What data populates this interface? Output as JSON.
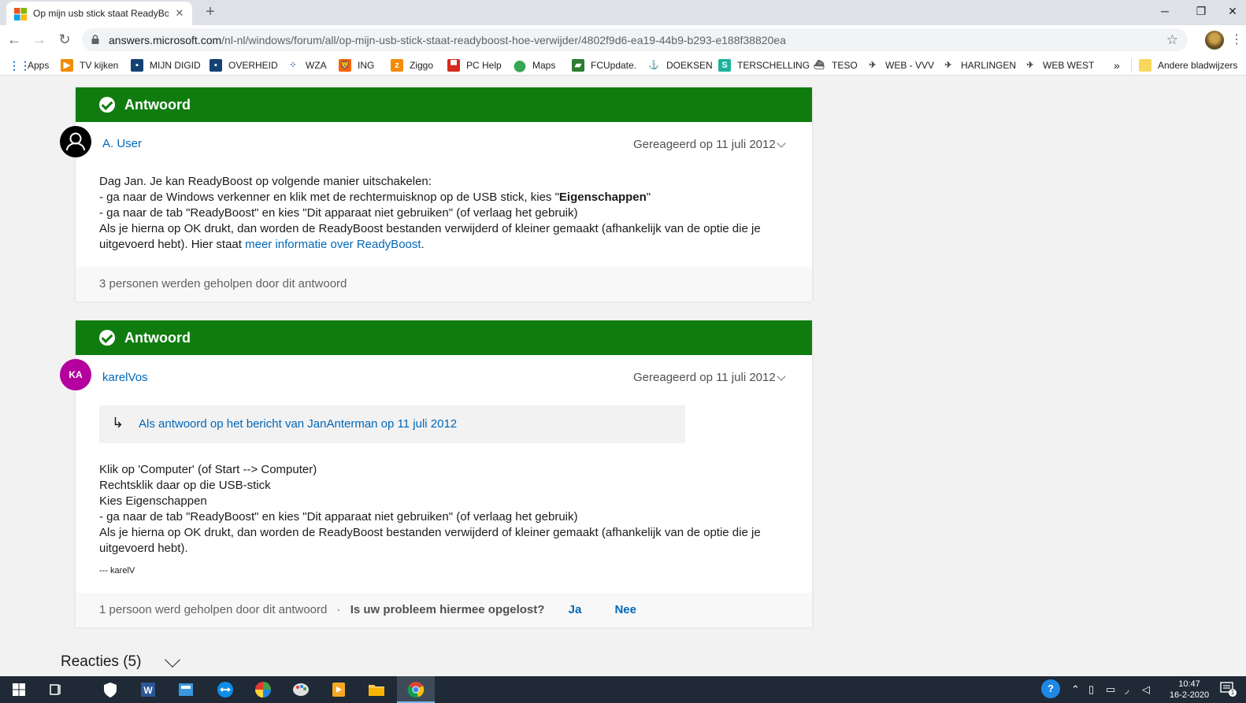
{
  "browser": {
    "tab_title": "Op mijn usb stick staat ReadyBoo",
    "url_host": "answers.microsoft.com",
    "url_path": "/nl-nl/windows/forum/all/op-mijn-usb-stick-staat-readyboost-hoe-verwijder/4802f9d6-ea19-44b9-b293-e188f38820ea",
    "bookmarks": [
      {
        "label": "Apps",
        "icon": "apps-grid-icon"
      },
      {
        "label": "TV kijken",
        "icon": "tv-icon"
      },
      {
        "label": "MIJN DIGID",
        "icon": "digid-icon"
      },
      {
        "label": "OVERHEID",
        "icon": "overheid-icon"
      },
      {
        "label": "WZA",
        "icon": "wza-icon"
      },
      {
        "label": "ING",
        "icon": "ing-icon"
      },
      {
        "label": "Ziggo",
        "icon": "ziggo-icon"
      },
      {
        "label": "PC Help",
        "icon": "pchelp-icon"
      },
      {
        "label": "Maps",
        "icon": "maps-pin-icon"
      },
      {
        "label": "FCUpdate.",
        "icon": "fcupdate-icon"
      },
      {
        "label": "DOEKSEN",
        "icon": "doeksen-icon"
      },
      {
        "label": "TERSCHELLING",
        "icon": "terschelling-icon"
      },
      {
        "label": "TESO",
        "icon": "teso-icon"
      },
      {
        "label": "WEB - VVV",
        "icon": "bird-icon"
      },
      {
        "label": "HARLINGEN",
        "icon": "bird-icon"
      },
      {
        "label": "WEB WEST",
        "icon": "bird-icon"
      }
    ],
    "more_bookmarks": "»",
    "other_bookmarks": "Andere bladwijzers"
  },
  "answers": [
    {
      "banner": "Antwoord",
      "user": "A. User",
      "date": "Gereageerd op 11 juli 2012",
      "lines": [
        "Dag Jan. Je kan ReadyBoost op volgende manier uitschakelen:",
        "- ga naar de Windows verkenner en klik met de rechtermuisknop op de USB stick, kies \"",
        "Eigenschappen",
        "\"",
        "- ga naar de tab \"ReadyBoost\" en kies \"Dit apparaat niet gebruiken\" (of verlaag het gebruik)",
        "Als je hierna op OK drukt, dan worden de ReadyBoost bestanden verwijderd of kleiner gemaakt (afhankelijk van de optie die je",
        "uitgevoerd hebt). Hier staat ",
        "meer informatie over ReadyBoost",
        "."
      ],
      "helped": "3 personen werden geholpen door dit antwoord"
    },
    {
      "banner": "Antwoord",
      "user": "karelVos",
      "avatar_initials": "KA",
      "date": "Gereageerd op 11 juli 2012",
      "quote": "Als antwoord op het bericht van JanAnterman op 11 juli 2012",
      "lines": [
        "Klik op 'Computer' (of  Start --> Computer)",
        "Rechtsklik daar op die USB-stick",
        "Kies Eigenschappen",
        "- ga naar de tab \"ReadyBoost\" en kies \"Dit apparaat niet gebruiken\" (of verlaag het gebruik)",
        "Als je hierna op OK drukt, dan worden de ReadyBoost bestanden verwijderd of kleiner gemaakt (afhankelijk van de optie die je",
        "uitgevoerd hebt)."
      ],
      "signature": "--- karelV",
      "helped": "1 persoon werd geholpen door dit antwoord",
      "separator": "·",
      "question": "Is uw probleem hiermee opgelost?",
      "yes": "Ja",
      "no": "Nee"
    }
  ],
  "reacties": "Reacties (5)",
  "taskbar": {
    "time": "10:47",
    "date": "16-2-2020",
    "notification_count": "1"
  },
  "colors": {
    "accent_green": "#107c10",
    "link_blue": "#0067b8",
    "avatar_magenta": "#b4009e"
  }
}
